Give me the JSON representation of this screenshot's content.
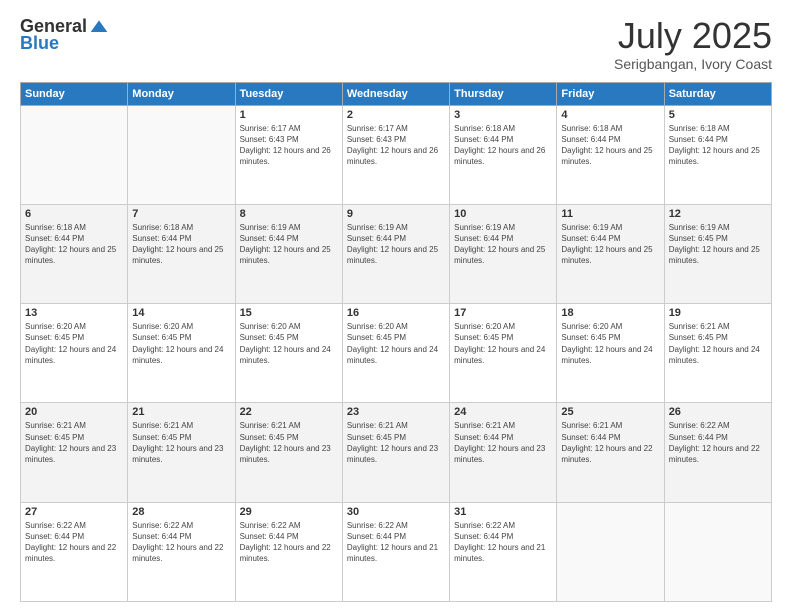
{
  "logo": {
    "general": "General",
    "blue": "Blue"
  },
  "header": {
    "month": "July 2025",
    "location": "Serigbangan, Ivory Coast"
  },
  "days_of_week": [
    "Sunday",
    "Monday",
    "Tuesday",
    "Wednesday",
    "Thursday",
    "Friday",
    "Saturday"
  ],
  "weeks": [
    {
      "alt": false,
      "days": [
        {
          "date": "",
          "empty": true
        },
        {
          "date": "",
          "empty": true
        },
        {
          "date": "1",
          "sunrise": "Sunrise: 6:17 AM",
          "sunset": "Sunset: 6:43 PM",
          "daylight": "Daylight: 12 hours and 26 minutes."
        },
        {
          "date": "2",
          "sunrise": "Sunrise: 6:17 AM",
          "sunset": "Sunset: 6:43 PM",
          "daylight": "Daylight: 12 hours and 26 minutes."
        },
        {
          "date": "3",
          "sunrise": "Sunrise: 6:18 AM",
          "sunset": "Sunset: 6:44 PM",
          "daylight": "Daylight: 12 hours and 26 minutes."
        },
        {
          "date": "4",
          "sunrise": "Sunrise: 6:18 AM",
          "sunset": "Sunset: 6:44 PM",
          "daylight": "Daylight: 12 hours and 25 minutes."
        },
        {
          "date": "5",
          "sunrise": "Sunrise: 6:18 AM",
          "sunset": "Sunset: 6:44 PM",
          "daylight": "Daylight: 12 hours and 25 minutes."
        }
      ]
    },
    {
      "alt": true,
      "days": [
        {
          "date": "6",
          "sunrise": "Sunrise: 6:18 AM",
          "sunset": "Sunset: 6:44 PM",
          "daylight": "Daylight: 12 hours and 25 minutes."
        },
        {
          "date": "7",
          "sunrise": "Sunrise: 6:18 AM",
          "sunset": "Sunset: 6:44 PM",
          "daylight": "Daylight: 12 hours and 25 minutes."
        },
        {
          "date": "8",
          "sunrise": "Sunrise: 6:19 AM",
          "sunset": "Sunset: 6:44 PM",
          "daylight": "Daylight: 12 hours and 25 minutes."
        },
        {
          "date": "9",
          "sunrise": "Sunrise: 6:19 AM",
          "sunset": "Sunset: 6:44 PM",
          "daylight": "Daylight: 12 hours and 25 minutes."
        },
        {
          "date": "10",
          "sunrise": "Sunrise: 6:19 AM",
          "sunset": "Sunset: 6:44 PM",
          "daylight": "Daylight: 12 hours and 25 minutes."
        },
        {
          "date": "11",
          "sunrise": "Sunrise: 6:19 AM",
          "sunset": "Sunset: 6:44 PM",
          "daylight": "Daylight: 12 hours and 25 minutes."
        },
        {
          "date": "12",
          "sunrise": "Sunrise: 6:19 AM",
          "sunset": "Sunset: 6:45 PM",
          "daylight": "Daylight: 12 hours and 25 minutes."
        }
      ]
    },
    {
      "alt": false,
      "days": [
        {
          "date": "13",
          "sunrise": "Sunrise: 6:20 AM",
          "sunset": "Sunset: 6:45 PM",
          "daylight": "Daylight: 12 hours and 24 minutes."
        },
        {
          "date": "14",
          "sunrise": "Sunrise: 6:20 AM",
          "sunset": "Sunset: 6:45 PM",
          "daylight": "Daylight: 12 hours and 24 minutes."
        },
        {
          "date": "15",
          "sunrise": "Sunrise: 6:20 AM",
          "sunset": "Sunset: 6:45 PM",
          "daylight": "Daylight: 12 hours and 24 minutes."
        },
        {
          "date": "16",
          "sunrise": "Sunrise: 6:20 AM",
          "sunset": "Sunset: 6:45 PM",
          "daylight": "Daylight: 12 hours and 24 minutes."
        },
        {
          "date": "17",
          "sunrise": "Sunrise: 6:20 AM",
          "sunset": "Sunset: 6:45 PM",
          "daylight": "Daylight: 12 hours and 24 minutes."
        },
        {
          "date": "18",
          "sunrise": "Sunrise: 6:20 AM",
          "sunset": "Sunset: 6:45 PM",
          "daylight": "Daylight: 12 hours and 24 minutes."
        },
        {
          "date": "19",
          "sunrise": "Sunrise: 6:21 AM",
          "sunset": "Sunset: 6:45 PM",
          "daylight": "Daylight: 12 hours and 24 minutes."
        }
      ]
    },
    {
      "alt": true,
      "days": [
        {
          "date": "20",
          "sunrise": "Sunrise: 6:21 AM",
          "sunset": "Sunset: 6:45 PM",
          "daylight": "Daylight: 12 hours and 23 minutes."
        },
        {
          "date": "21",
          "sunrise": "Sunrise: 6:21 AM",
          "sunset": "Sunset: 6:45 PM",
          "daylight": "Daylight: 12 hours and 23 minutes."
        },
        {
          "date": "22",
          "sunrise": "Sunrise: 6:21 AM",
          "sunset": "Sunset: 6:45 PM",
          "daylight": "Daylight: 12 hours and 23 minutes."
        },
        {
          "date": "23",
          "sunrise": "Sunrise: 6:21 AM",
          "sunset": "Sunset: 6:45 PM",
          "daylight": "Daylight: 12 hours and 23 minutes."
        },
        {
          "date": "24",
          "sunrise": "Sunrise: 6:21 AM",
          "sunset": "Sunset: 6:44 PM",
          "daylight": "Daylight: 12 hours and 23 minutes."
        },
        {
          "date": "25",
          "sunrise": "Sunrise: 6:21 AM",
          "sunset": "Sunset: 6:44 PM",
          "daylight": "Daylight: 12 hours and 22 minutes."
        },
        {
          "date": "26",
          "sunrise": "Sunrise: 6:22 AM",
          "sunset": "Sunset: 6:44 PM",
          "daylight": "Daylight: 12 hours and 22 minutes."
        }
      ]
    },
    {
      "alt": false,
      "days": [
        {
          "date": "27",
          "sunrise": "Sunrise: 6:22 AM",
          "sunset": "Sunset: 6:44 PM",
          "daylight": "Daylight: 12 hours and 22 minutes."
        },
        {
          "date": "28",
          "sunrise": "Sunrise: 6:22 AM",
          "sunset": "Sunset: 6:44 PM",
          "daylight": "Daylight: 12 hours and 22 minutes."
        },
        {
          "date": "29",
          "sunrise": "Sunrise: 6:22 AM",
          "sunset": "Sunset: 6:44 PM",
          "daylight": "Daylight: 12 hours and 22 minutes."
        },
        {
          "date": "30",
          "sunrise": "Sunrise: 6:22 AM",
          "sunset": "Sunset: 6:44 PM",
          "daylight": "Daylight: 12 hours and 21 minutes."
        },
        {
          "date": "31",
          "sunrise": "Sunrise: 6:22 AM",
          "sunset": "Sunset: 6:44 PM",
          "daylight": "Daylight: 12 hours and 21 minutes."
        },
        {
          "date": "",
          "empty": true
        },
        {
          "date": "",
          "empty": true
        }
      ]
    }
  ]
}
